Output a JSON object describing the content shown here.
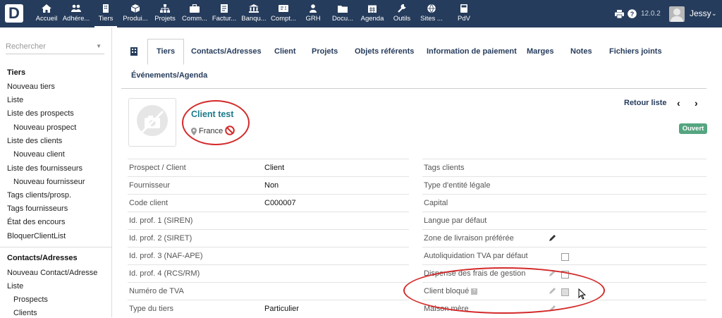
{
  "brand": {
    "logo_letter": "D"
  },
  "topmenu": {
    "items": [
      {
        "label": "Accueil",
        "icon": "home-icon"
      },
      {
        "label": "Adhére...",
        "icon": "members-icon"
      },
      {
        "label": "Tiers",
        "icon": "building-icon"
      },
      {
        "label": "Produi...",
        "icon": "cube-icon"
      },
      {
        "label": "Projets",
        "icon": "sitemap-icon"
      },
      {
        "label": "Comm...",
        "icon": "briefcase-icon"
      },
      {
        "label": "Factur...",
        "icon": "invoice-icon"
      },
      {
        "label": "Banqu...",
        "icon": "bank-icon"
      },
      {
        "label": "Compt...",
        "icon": "accounting-icon"
      },
      {
        "label": "GRH",
        "icon": "user-icon"
      },
      {
        "label": "Docu...",
        "icon": "folder-icon"
      },
      {
        "label": "Agenda",
        "icon": "calendar-icon"
      },
      {
        "label": "Outils",
        "icon": "wrench-icon"
      },
      {
        "label": "Sites ...",
        "icon": "globe-icon"
      },
      {
        "label": "PdV",
        "icon": "pos-icon"
      }
    ],
    "version": "12.0.2",
    "user": "Jessy"
  },
  "sidebar": {
    "search_placeholder": "Rechercher",
    "group1": {
      "title": "Tiers",
      "items": [
        "Nouveau tiers",
        "Liste",
        "Liste des prospects",
        "Nouveau prospect",
        "Liste des clients",
        "Nouveau client",
        "Liste des fournisseurs",
        "Nouveau fournisseur",
        "Tags clients/prosp.",
        "Tags fournisseurs",
        "État des encours",
        "BloquerClientList"
      ]
    },
    "group2": {
      "title": "Contacts/Adresses",
      "items": [
        "Nouveau Contact/Adresse",
        "Liste",
        "Prospects",
        "Clients"
      ]
    }
  },
  "tabs": [
    "Tiers",
    "Contacts/Adresses",
    "Client",
    "Projets",
    "Objets référents",
    "Information de paiement",
    "Marges",
    "Notes",
    "Fichiers joints",
    "Événements/Agenda"
  ],
  "header": {
    "name": "Client test",
    "country": "France",
    "back_label": "Retour liste",
    "status": "Ouvert"
  },
  "left_fields": [
    {
      "label": "Prospect / Client",
      "value": "Client"
    },
    {
      "label": "Fournisseur",
      "value": "Non"
    },
    {
      "label": "Code client",
      "value": "C000007"
    },
    {
      "label": "Id. prof. 1 (SIREN)",
      "value": ""
    },
    {
      "label": "Id. prof. 2 (SIRET)",
      "value": ""
    },
    {
      "label": "Id. prof. 3 (NAF-APE)",
      "value": ""
    },
    {
      "label": "Id. prof. 4 (RCS/RM)",
      "value": ""
    },
    {
      "label": "Numéro de TVA",
      "value": ""
    },
    {
      "label": "Type du tiers",
      "value": "Particulier"
    }
  ],
  "right_fields": [
    {
      "label": "Tags clients"
    },
    {
      "label": "Type d'entité légale"
    },
    {
      "label": "Capital"
    },
    {
      "label": "Langue par défaut"
    },
    {
      "label": "Zone de livraison préférée"
    },
    {
      "label": "Autoliquidation TVA par défaut"
    },
    {
      "label": "Dispense des frais de gestion"
    },
    {
      "label": "Client bloqué"
    },
    {
      "label": "Maison mère"
    }
  ],
  "colors": {
    "topbar": "#263c5c",
    "accent_link": "#1a7a8a",
    "status_open": "#55a580",
    "annotation": "#d42a2a"
  }
}
